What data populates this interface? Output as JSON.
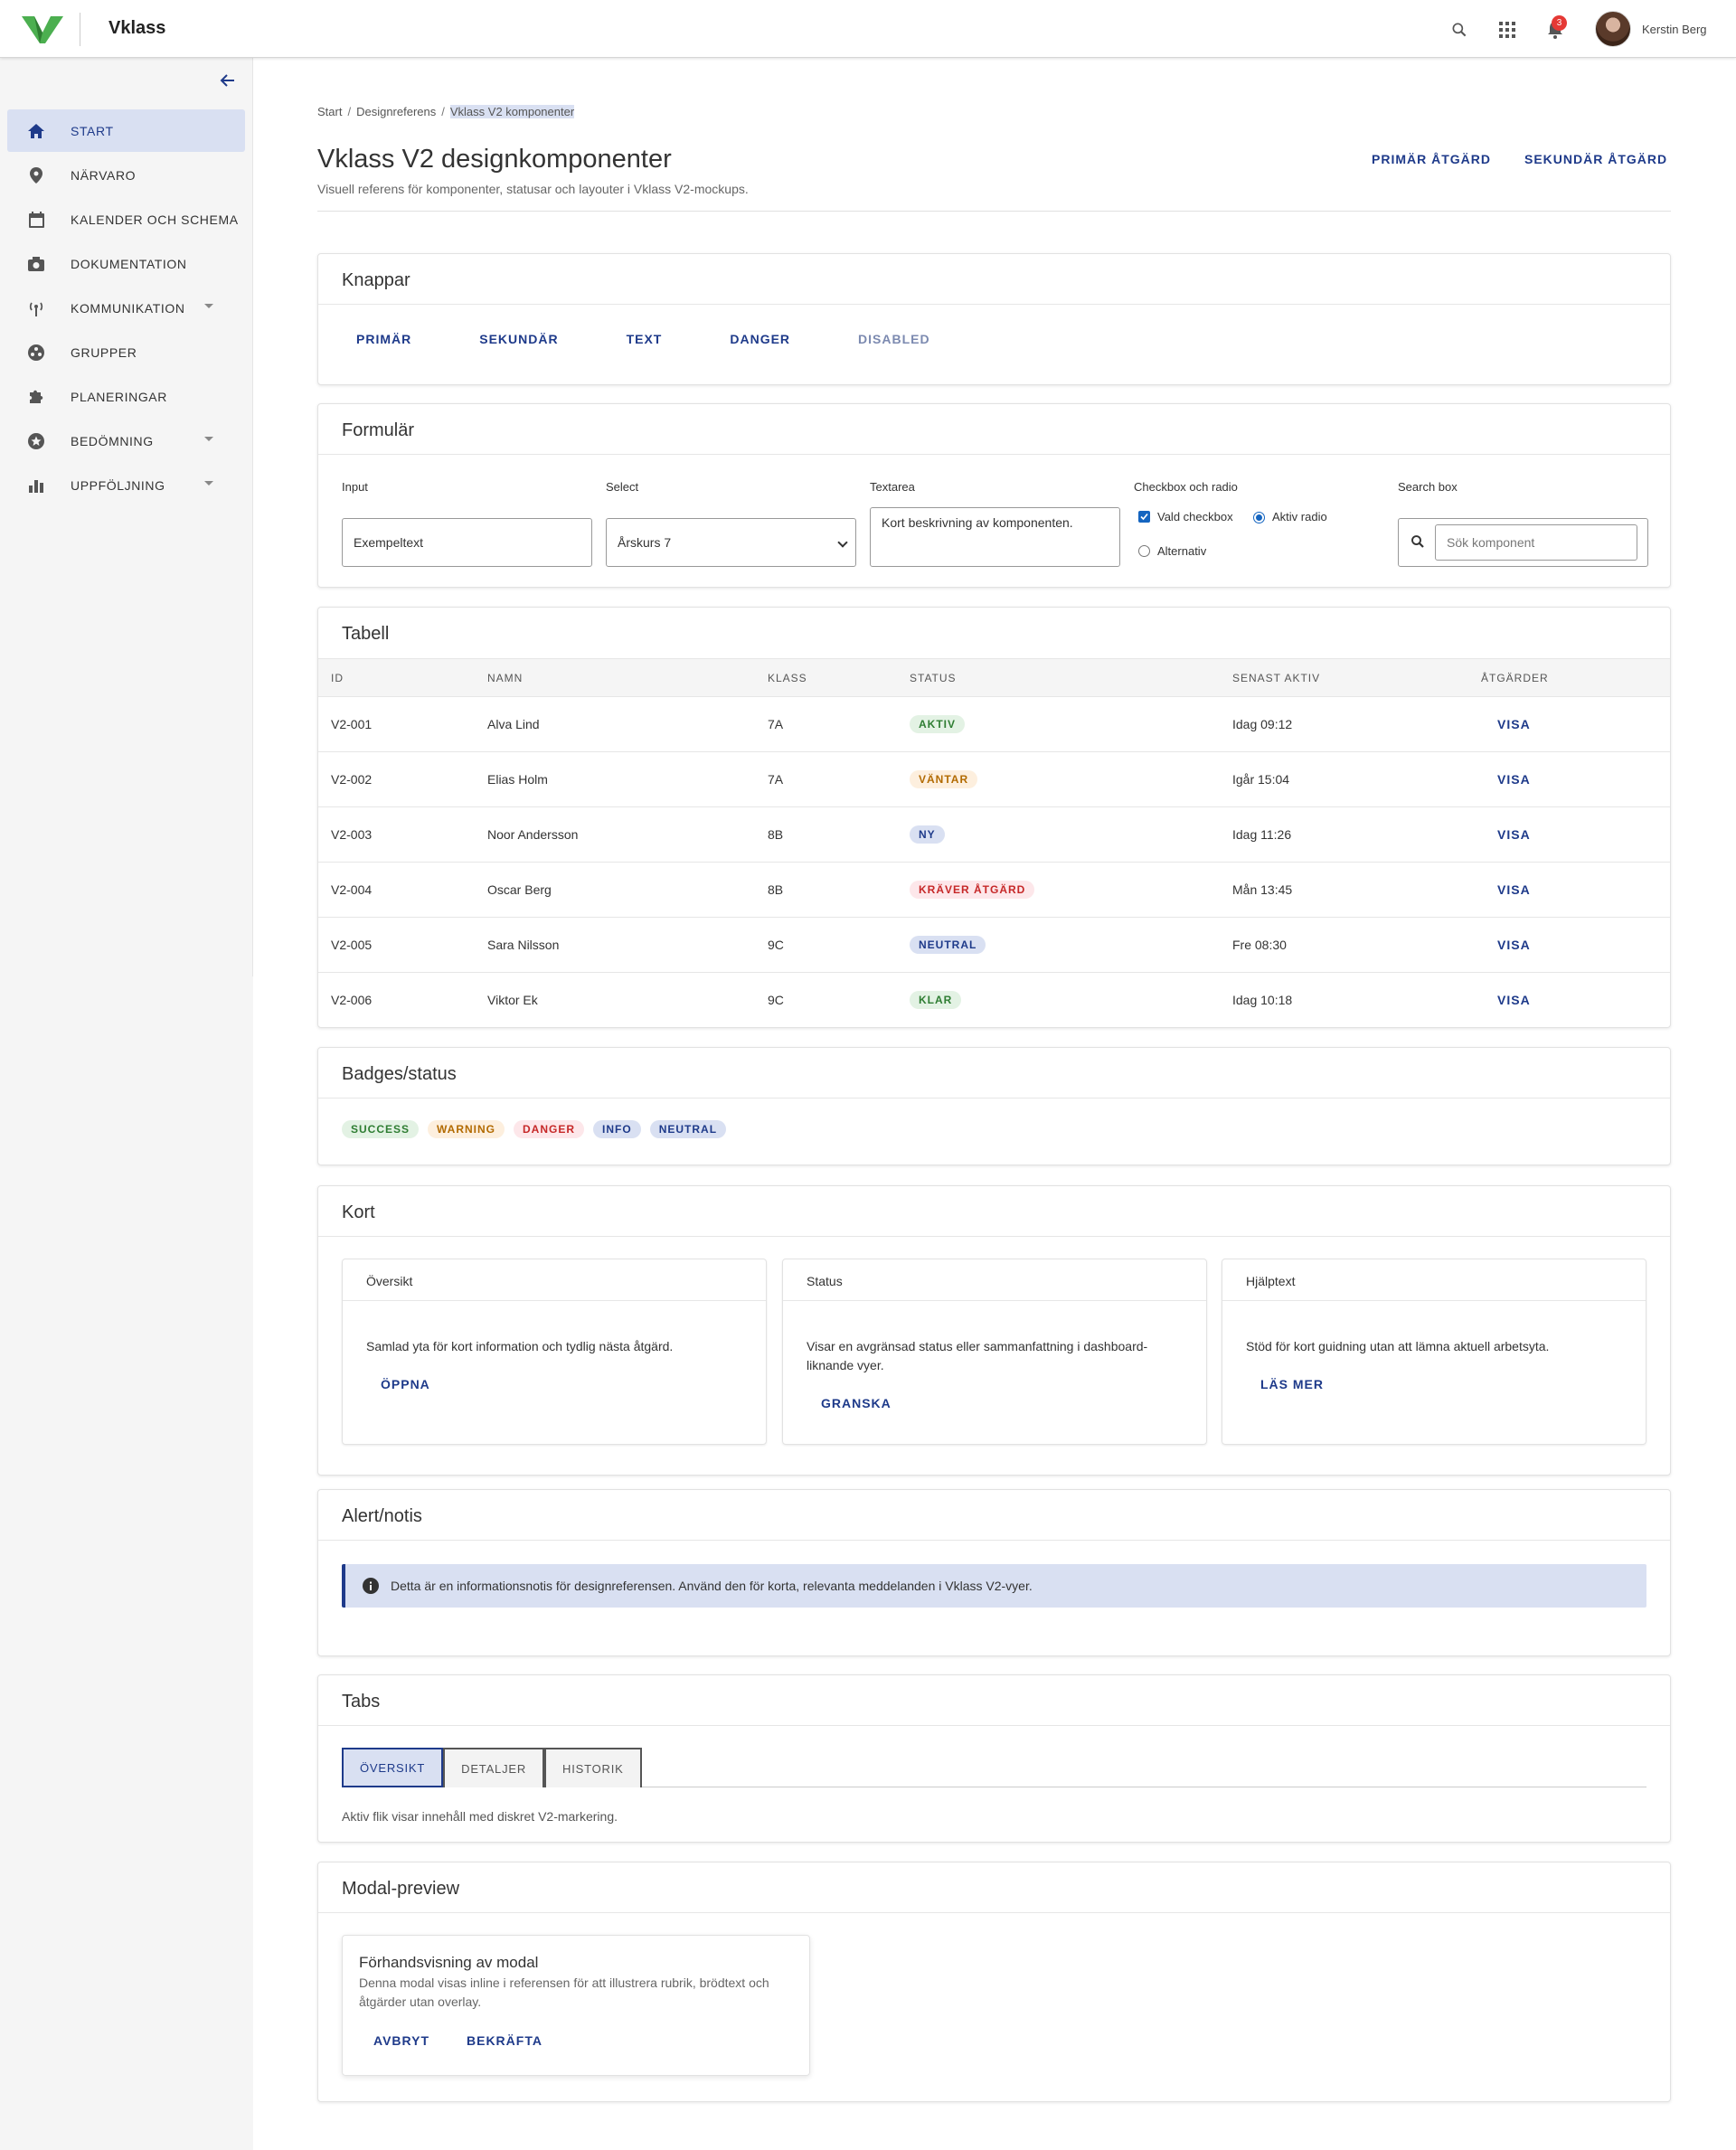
{
  "app": {
    "brand": "Vklass",
    "user_name": "Kerstin Berg",
    "notification_count": "3"
  },
  "colors": {
    "accent": "#1e3a8a",
    "active_bg": "#d9e0f2",
    "logo_green": "#4caf50"
  },
  "sidebar": {
    "items": [
      {
        "label": "START",
        "icon": "home-icon",
        "active": true
      },
      {
        "label": "NÄRVARO",
        "icon": "location-pin-icon"
      },
      {
        "label": "KALENDER OCH SCHEMA",
        "icon": "calendar-icon"
      },
      {
        "label": "DOKUMENTATION",
        "icon": "camera-icon"
      },
      {
        "label": "KOMMUNIKATION",
        "icon": "broadcast-icon",
        "expandable": true
      },
      {
        "label": "GRUPPER",
        "icon": "groups-icon"
      },
      {
        "label": "PLANERINGAR",
        "icon": "puzzle-icon"
      },
      {
        "label": "BEDÖMNING",
        "icon": "star-badge-icon",
        "expandable": true
      },
      {
        "label": "UPPFÖLJNING",
        "icon": "bar-chart-icon",
        "expandable": true
      }
    ]
  },
  "breadcrumb": [
    "Start",
    "Designreferens",
    "Vklass V2 komponenter"
  ],
  "page": {
    "title": "Vklass V2 designkomponenter",
    "subtitle": "Visuell referens för komponenter, statusar och layouter i Vklass V2-mockups.",
    "primary_action": "PRIMÄR ÅTGÄRD",
    "secondary_action": "SEKUNDÄR ÅTGÄRD"
  },
  "buttons_section": {
    "title": "Knappar",
    "buttons": [
      "PRIMÄR",
      "SEKUNDÄR",
      "TEXT",
      "DANGER",
      "DISABLED"
    ]
  },
  "form_section": {
    "title": "Formulär",
    "input_label": "Input",
    "input_value": "Exempeltext",
    "select_label": "Select",
    "select_value": "Årskurs 7",
    "textarea_label": "Textarea",
    "textarea_value": "Kort beskrivning av komponenten.",
    "check_label": "Checkbox och radio",
    "checkbox_text": "Vald checkbox",
    "radio_active": "Aktiv radio",
    "radio_alt": "Alternativ",
    "search_label": "Search box",
    "search_placeholder": "Sök komponent"
  },
  "table_section": {
    "title": "Tabell",
    "headers": [
      "ID",
      "NAMN",
      "KLASS",
      "STATUS",
      "SENAST AKTIV",
      "ÅTGÄRDER"
    ],
    "rows": [
      {
        "id": "V2-001",
        "name": "Alva Lind",
        "klass": "7A",
        "status": "AKTIV",
        "status_type": "success",
        "last": "Idag 09:12",
        "action": "VISA"
      },
      {
        "id": "V2-002",
        "name": "Elias Holm",
        "klass": "7A",
        "status": "VÄNTAR",
        "status_type": "warning",
        "last": "Igår 15:04",
        "action": "VISA"
      },
      {
        "id": "V2-003",
        "name": "Noor Andersson",
        "klass": "8B",
        "status": "NY",
        "status_type": "info",
        "last": "Idag 11:26",
        "action": "VISA"
      },
      {
        "id": "V2-004",
        "name": "Oscar Berg",
        "klass": "8B",
        "status": "KRÄVER ÅTGÄRD",
        "status_type": "danger",
        "last": "Mån 13:45",
        "action": "VISA"
      },
      {
        "id": "V2-005",
        "name": "Sara Nilsson",
        "klass": "9C",
        "status": "NEUTRAL",
        "status_type": "neutral",
        "last": "Fre 08:30",
        "action": "VISA"
      },
      {
        "id": "V2-006",
        "name": "Viktor Ek",
        "klass": "9C",
        "status": "KLAR",
        "status_type": "success",
        "last": "Idag 10:18",
        "action": "VISA"
      }
    ]
  },
  "badges_section": {
    "title": "Badges/status",
    "badges": [
      {
        "label": "SUCCESS",
        "type": "success"
      },
      {
        "label": "WARNING",
        "type": "warning"
      },
      {
        "label": "DANGER",
        "type": "danger"
      },
      {
        "label": "INFO",
        "type": "info"
      },
      {
        "label": "NEUTRAL",
        "type": "neutral"
      }
    ]
  },
  "cards_section": {
    "title": "Kort",
    "cards": [
      {
        "title": "Översikt",
        "text": "Samlad yta för kort information och tydlig nästa åtgärd.",
        "action": "ÖPPNA"
      },
      {
        "title": "Status",
        "text": "Visar en avgränsad status eller sammanfattning i dashboard-liknande vyer.",
        "action": "GRANSKA"
      },
      {
        "title": "Hjälptext",
        "text": "Stöd för kort guidning utan att lämna aktuell arbetsyta.",
        "action": "LÄS MER"
      }
    ]
  },
  "alert_section": {
    "title": "Alert/notis",
    "text": "Detta är en informationsnotis för designreferensen. Använd den för korta, relevanta meddelanden i Vklass V2-vyer."
  },
  "tabs_section": {
    "title": "Tabs",
    "tabs": [
      "ÖVERSIKT",
      "DETALJER",
      "HISTORIK"
    ],
    "content": "Aktiv flik visar innehåll med diskret V2-markering."
  },
  "modal_section": {
    "title": "Modal-preview",
    "modal_title": "Förhandsvisning av modal",
    "modal_text": "Denna modal visas inline i referensen för att illustrera rubrik, brödtext och åtgärder utan overlay.",
    "cancel": "AVBRYT",
    "confirm": "BEKRÄFTA"
  }
}
